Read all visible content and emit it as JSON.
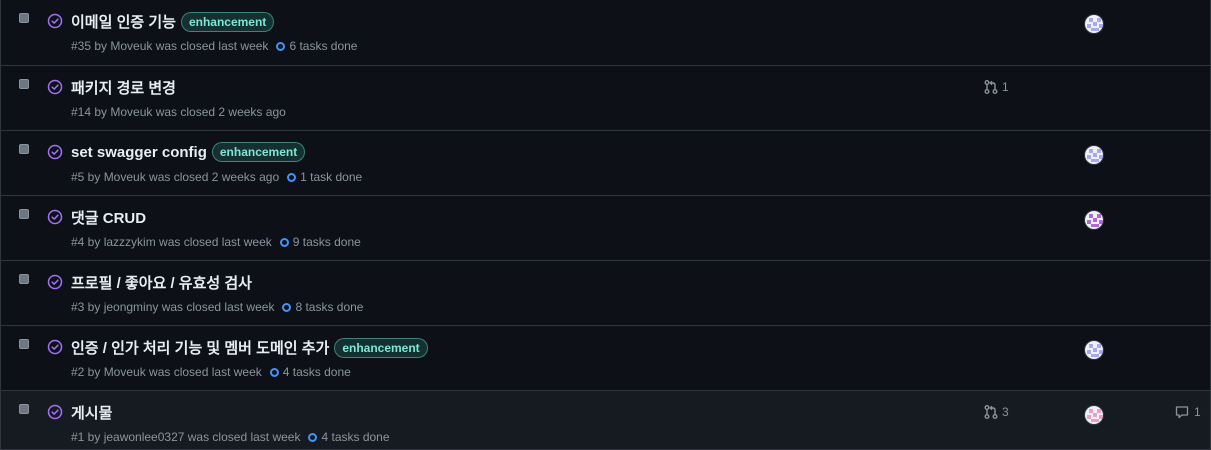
{
  "issues": [
    {
      "title": "이메일 인증 기능",
      "label": "enhancement",
      "meta": "#35 by Moveuk was closed last week",
      "tasks": "6 tasks done",
      "pr_count": "",
      "avatar_color": "#a7a9f0",
      "comments": ""
    },
    {
      "title": "패키지 경로 변경",
      "label": "",
      "meta": "#14 by Moveuk was closed 2 weeks ago",
      "tasks": "",
      "pr_count": "1",
      "avatar_color": "",
      "comments": ""
    },
    {
      "title": "set swagger config",
      "label": "enhancement",
      "meta": "#5 by Moveuk was closed 2 weeks ago",
      "tasks": "1 task done",
      "pr_count": "",
      "avatar_color": "#a7a9f0",
      "comments": ""
    },
    {
      "title": "댓글 CRUD",
      "label": "",
      "meta": "#4 by lazzzykim was closed last week",
      "tasks": "9 tasks done",
      "pr_count": "",
      "avatar_color": "#b06ad6",
      "comments": ""
    },
    {
      "title": "프로필 / 좋아요 / 유효성 검사",
      "label": "",
      "meta": "#3 by jeongminy was closed last week",
      "tasks": "8 tasks done",
      "pr_count": "",
      "avatar_color": "",
      "comments": ""
    },
    {
      "title": "인증 / 인가 처리 기능 및 멤버 도메인 추가",
      "label": "enhancement",
      "meta": "#2 by Moveuk was closed last week",
      "tasks": "4 tasks done",
      "pr_count": "",
      "avatar_color": "#a7a9f0",
      "comments": ""
    },
    {
      "title": "게시물",
      "label": "",
      "meta": "#1 by jeawonlee0327 was closed last week",
      "tasks": "4 tasks done",
      "pr_count": "3",
      "avatar_color": "#e6a1c4",
      "comments": "1"
    }
  ],
  "colors": {
    "closed_purple": "#a371f7",
    "label_teal": "#7ee7d8",
    "task_blue": "#4493f8"
  }
}
